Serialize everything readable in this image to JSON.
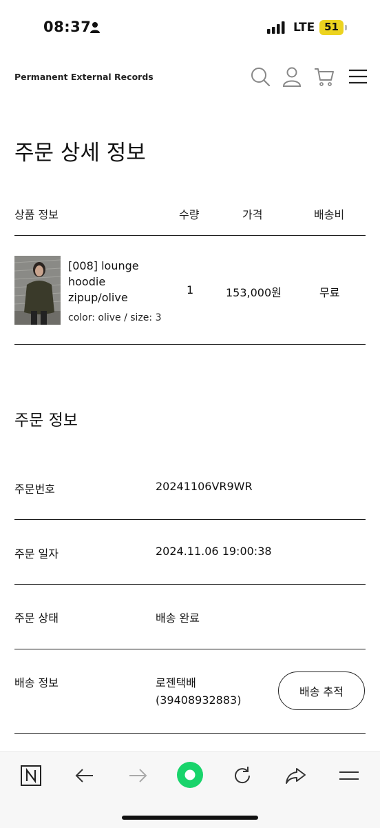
{
  "status_bar": {
    "time": "08:37",
    "network": "LTE",
    "battery": "51"
  },
  "header": {
    "brand": "Permanent External Records"
  },
  "page_title": "주문 상세 정보",
  "product_table": {
    "headers": {
      "product": "상품 정보",
      "qty": "수량",
      "price": "가격",
      "shipping": "배송비"
    },
    "item": {
      "name": "[008] lounge hoodie zipup/olive",
      "options": "color: olive / size: 3",
      "qty": "1",
      "price": "153,000원",
      "shipping": "무료"
    }
  },
  "order_info": {
    "title": "주문 정보",
    "rows": [
      {
        "label": "주문번호",
        "value": "20241106VR9WR"
      },
      {
        "label": "주문 일자",
        "value": "2024.11.06 19:00:38"
      },
      {
        "label": "주문 상태",
        "value": "배송 완료"
      },
      {
        "label": "배송 정보",
        "value": "로젠택배",
        "value2": "(39408932883)"
      }
    ],
    "track_button": "배송 추적"
  },
  "browser_bar": {
    "icons": [
      "naver-n-icon",
      "back-arrow-icon",
      "forward-arrow-icon",
      "home-circle-icon",
      "reload-icon",
      "share-icon",
      "menu-icon"
    ],
    "accent": "#19d46b"
  }
}
